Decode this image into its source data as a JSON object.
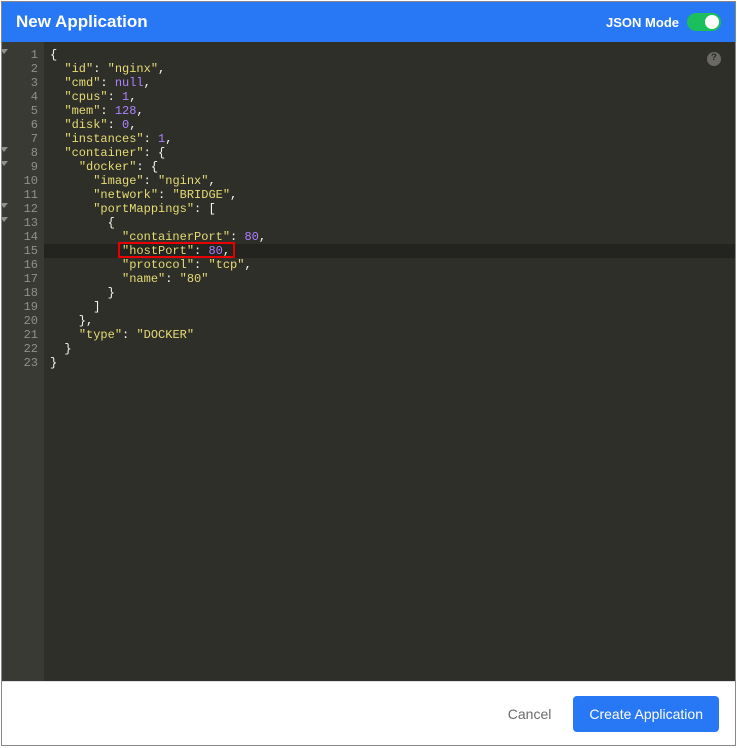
{
  "header": {
    "title": "New Application",
    "jsonModeLabel": "JSON Mode",
    "jsonModeOn": true
  },
  "help": {
    "glyph": "?"
  },
  "footer": {
    "cancel": "Cancel",
    "create": "Create Application"
  },
  "editor": {
    "lineCount": 23,
    "foldLines": [
      1,
      8,
      9,
      12,
      13
    ],
    "highlightedLine": 15,
    "redHighlight": {
      "line": 15,
      "text": "\"hostPort\": 80,"
    },
    "tokens": [
      [
        [
          "punc",
          "{"
        ]
      ],
      [
        [
          "punc",
          "  "
        ],
        [
          "str",
          "\"id\""
        ],
        [
          "punc",
          ": "
        ],
        [
          "str",
          "\"nginx\""
        ],
        [
          "punc",
          ","
        ]
      ],
      [
        [
          "punc",
          "  "
        ],
        [
          "str",
          "\"cmd\""
        ],
        [
          "punc",
          ": "
        ],
        [
          "null",
          "null"
        ],
        [
          "punc",
          ","
        ]
      ],
      [
        [
          "punc",
          "  "
        ],
        [
          "str",
          "\"cpus\""
        ],
        [
          "punc",
          ": "
        ],
        [
          "num",
          "1"
        ],
        [
          "punc",
          ","
        ]
      ],
      [
        [
          "punc",
          "  "
        ],
        [
          "str",
          "\"mem\""
        ],
        [
          "punc",
          ": "
        ],
        [
          "num",
          "128"
        ],
        [
          "punc",
          ","
        ]
      ],
      [
        [
          "punc",
          "  "
        ],
        [
          "str",
          "\"disk\""
        ],
        [
          "punc",
          ": "
        ],
        [
          "num",
          "0"
        ],
        [
          "punc",
          ","
        ]
      ],
      [
        [
          "punc",
          "  "
        ],
        [
          "str",
          "\"instances\""
        ],
        [
          "punc",
          ": "
        ],
        [
          "num",
          "1"
        ],
        [
          "punc",
          ","
        ]
      ],
      [
        [
          "punc",
          "  "
        ],
        [
          "str",
          "\"container\""
        ],
        [
          "punc",
          ": {"
        ]
      ],
      [
        [
          "punc",
          "    "
        ],
        [
          "str",
          "\"docker\""
        ],
        [
          "punc",
          ": {"
        ]
      ],
      [
        [
          "punc",
          "      "
        ],
        [
          "str",
          "\"image\""
        ],
        [
          "punc",
          ": "
        ],
        [
          "str",
          "\"nginx\""
        ],
        [
          "punc",
          ","
        ]
      ],
      [
        [
          "punc",
          "      "
        ],
        [
          "str",
          "\"network\""
        ],
        [
          "punc",
          ": "
        ],
        [
          "str",
          "\"BRIDGE\""
        ],
        [
          "punc",
          ","
        ]
      ],
      [
        [
          "punc",
          "      "
        ],
        [
          "str",
          "\"portMappings\""
        ],
        [
          "punc",
          ": ["
        ]
      ],
      [
        [
          "punc",
          "        {"
        ]
      ],
      [
        [
          "punc",
          "          "
        ],
        [
          "str",
          "\"containerPort\""
        ],
        [
          "punc",
          ": "
        ],
        [
          "num",
          "80"
        ],
        [
          "punc",
          ","
        ]
      ],
      [
        [
          "punc",
          "          "
        ],
        [
          "str",
          "\"hostPort\""
        ],
        [
          "punc",
          ": "
        ],
        [
          "num",
          "80"
        ],
        [
          "punc",
          ","
        ]
      ],
      [
        [
          "punc",
          "          "
        ],
        [
          "str",
          "\"protocol\""
        ],
        [
          "punc",
          ": "
        ],
        [
          "str",
          "\"tcp\""
        ],
        [
          "punc",
          ","
        ]
      ],
      [
        [
          "punc",
          "          "
        ],
        [
          "str",
          "\"name\""
        ],
        [
          "punc",
          ": "
        ],
        [
          "str",
          "\"80\""
        ]
      ],
      [
        [
          "punc",
          "        }"
        ]
      ],
      [
        [
          "punc",
          "      ]"
        ]
      ],
      [
        [
          "punc",
          "    },"
        ]
      ],
      [
        [
          "punc",
          "    "
        ],
        [
          "str",
          "\"type\""
        ],
        [
          "punc",
          ": "
        ],
        [
          "str",
          "\"DOCKER\""
        ]
      ],
      [
        [
          "punc",
          "  }"
        ]
      ],
      [
        [
          "punc",
          "}"
        ]
      ]
    ],
    "jsonValue": {
      "id": "nginx",
      "cmd": null,
      "cpus": 1,
      "mem": 128,
      "disk": 0,
      "instances": 1,
      "container": {
        "docker": {
          "image": "nginx",
          "network": "BRIDGE",
          "portMappings": [
            {
              "containerPort": 80,
              "hostPort": 80,
              "protocol": "tcp",
              "name": "80"
            }
          ]
        },
        "type": "DOCKER"
      }
    }
  }
}
